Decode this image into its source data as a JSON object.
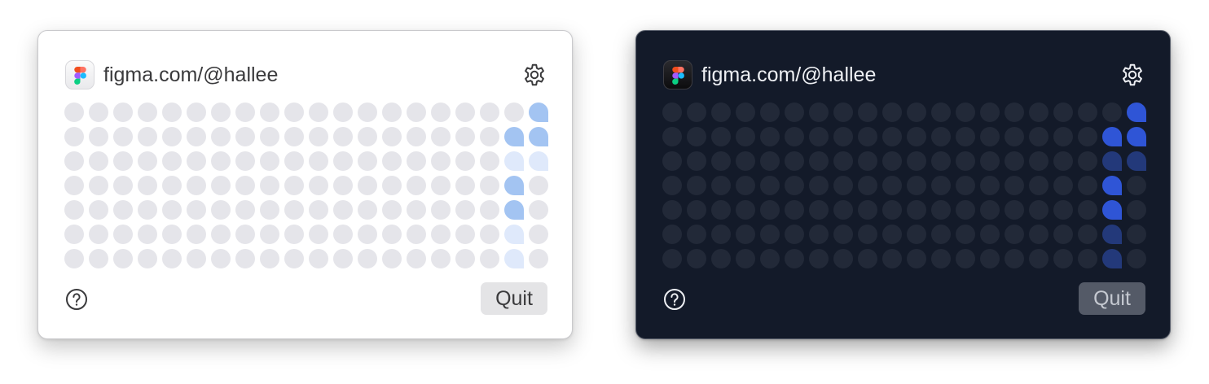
{
  "panels": [
    {
      "theme": "light",
      "title": "figma.com/@hallee",
      "quit_label": "Quit",
      "icons": {
        "app": "figma-logo-icon",
        "settings": "gear-icon",
        "help": "help-circle-icon"
      },
      "colors": {
        "text": "#3a3a3c",
        "level": {
          "0": "#e5e5ea",
          "1": "#dfe9fb",
          "2": "#a3c4f2",
          "3": "#8fb6ef"
        }
      }
    },
    {
      "theme": "dark",
      "title": "figma.com/@hallee",
      "quit_label": "Quit",
      "icons": {
        "app": "figma-logo-icon",
        "settings": "gear-icon",
        "help": "help-circle-icon"
      },
      "colors": {
        "text": "#eef0f4",
        "level": {
          "0": "#222938",
          "1": "#23397a",
          "2": "#2f55d6",
          "3": "#3a64e4"
        }
      }
    }
  ],
  "contributions": {
    "weeks": 20,
    "days": 7,
    "active": [
      {
        "week": 18,
        "day": 1,
        "level": 2
      },
      {
        "week": 18,
        "day": 2,
        "level": 1
      },
      {
        "week": 18,
        "day": 3,
        "level": 2
      },
      {
        "week": 18,
        "day": 4,
        "level": 2
      },
      {
        "week": 18,
        "day": 5,
        "level": 1
      },
      {
        "week": 18,
        "day": 6,
        "level": 1
      },
      {
        "week": 19,
        "day": 0,
        "level": 2
      },
      {
        "week": 19,
        "day": 1,
        "level": 2
      },
      {
        "week": 19,
        "day": 2,
        "level": 1
      }
    ]
  }
}
